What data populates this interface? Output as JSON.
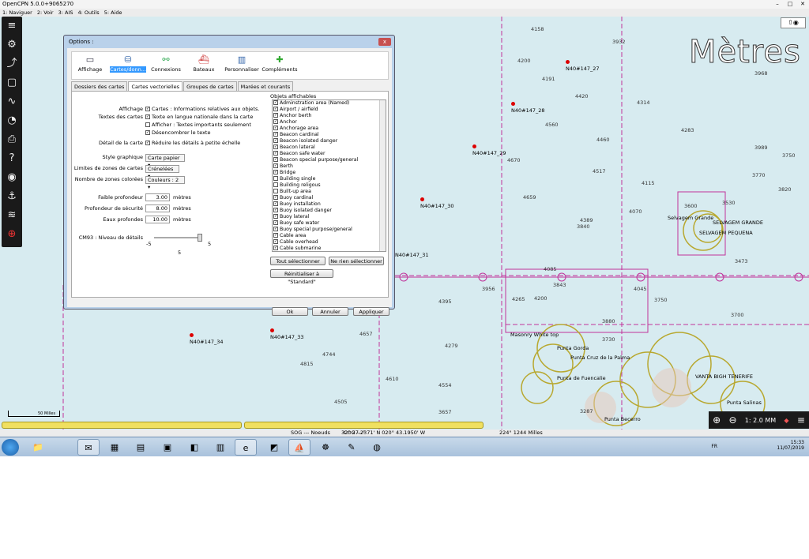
{
  "window": {
    "title": "OpenCPN 5.0.0+9065270"
  },
  "menubar": {
    "items": [
      "1: Naviguer",
      "2: Voir",
      "3: AIS",
      "4: Outils",
      "5: Aide"
    ]
  },
  "chart_overlay": {
    "units_label": "Mètres"
  },
  "depths": [
    {
      "v": "4158"
    },
    {
      "v": "3932"
    },
    {
      "v": "3968"
    },
    {
      "v": "4200"
    },
    {
      "v": "4191"
    },
    {
      "v": "4420"
    },
    {
      "v": "4314"
    },
    {
      "v": "4560"
    },
    {
      "v": "4460"
    },
    {
      "v": "4283"
    },
    {
      "v": "4670"
    },
    {
      "v": "4517"
    },
    {
      "v": "4115"
    },
    {
      "v": "4659"
    },
    {
      "v": "4389"
    },
    {
      "v": "4070"
    },
    {
      "v": "3840"
    },
    {
      "v": "3989"
    },
    {
      "v": "3750"
    },
    {
      "v": "3770"
    },
    {
      "v": "3820"
    },
    {
      "v": "3530"
    },
    {
      "v": "3600"
    },
    {
      "v": "3473"
    },
    {
      "v": "4395"
    },
    {
      "v": "4265"
    },
    {
      "v": "4200"
    },
    {
      "v": "4657"
    },
    {
      "v": "4279"
    },
    {
      "v": "4744"
    },
    {
      "v": "4815"
    },
    {
      "v": "4610"
    },
    {
      "v": "4554"
    },
    {
      "v": "4505"
    },
    {
      "v": "3657"
    },
    {
      "v": "3956"
    },
    {
      "v": "4085"
    },
    {
      "v": "3843"
    },
    {
      "v": "4045"
    },
    {
      "v": "3880"
    },
    {
      "v": "3730"
    },
    {
      "v": "3750"
    },
    {
      "v": "3700"
    },
    {
      "v": "3287"
    }
  ],
  "waypoints": [
    {
      "label": "N40#147_27"
    },
    {
      "label": "N40#147_28"
    },
    {
      "label": "N40#147_29"
    },
    {
      "label": "N40#147_30"
    },
    {
      "label": "N40#147_31"
    },
    {
      "label": "N40#147_33"
    },
    {
      "label": "N40#147_34"
    }
  ],
  "places": [
    {
      "label": "Selvagem Grande"
    },
    {
      "label": "SELVAGEM GRANDE"
    },
    {
      "label": "SELVAGEM PEQUENA"
    },
    {
      "label": "Punta Gorda"
    },
    {
      "label": "Punta Cruz de la Palma"
    },
    {
      "label": "Punta de Fuencalie"
    },
    {
      "label": "VANTA BIGH TENERIFE"
    },
    {
      "label": "Punta Salinas"
    },
    {
      "label": "Punta Becerro"
    },
    {
      "label": "Masonry White top"
    }
  ],
  "scale": {
    "label": "50 Milles",
    "zoom": "1: 2.0 MM"
  },
  "status": {
    "sog": "SOG --- Noeuds",
    "cog": "COG ---°",
    "pos": "32° 27.2371' N   020° 43.1950' W",
    "brg": "224°  1244 Milles"
  },
  "dialog": {
    "title": "Options :",
    "close_label": "x",
    "categories": [
      {
        "label": "Affichage",
        "icon": "display-icon"
      },
      {
        "label": "Cartes/donn...",
        "icon": "charts-icon"
      },
      {
        "label": "Connexions",
        "icon": "connections-icon"
      },
      {
        "label": "Bateaux",
        "icon": "ships-icon"
      },
      {
        "label": "Personnaliser",
        "icon": "customize-icon"
      },
      {
        "label": "Compléments",
        "icon": "plugins-icon"
      }
    ],
    "tabs": [
      "Dossiers des cartes",
      "Cartes vectorielles",
      "Groupes de cartes",
      "Marées et courants"
    ],
    "form": {
      "affichage_label": "Affichage",
      "affichage_cb": "Cartes : Informations relatives aux objets.",
      "textes_label": "Textes des cartes",
      "textes_cb1": "Texte en langue nationale dans la carte",
      "textes_cb2": "Afficher : Textes importants seulement",
      "textes_cb3": "Désencombrer le texte",
      "detail_label": "Détail de la carte",
      "detail_cb": "Réduire les détails à petite échelle",
      "style_label": "Style graphique",
      "style_value": "Carte papier",
      "limites_label": "Limites de zones de cartes",
      "limites_value": "Crénelées",
      "zones_label": "Nombre de zones colorées",
      "zones_value": "Couleurs : 2",
      "faible_label": "Faible profondeur",
      "faible_value": "3.00",
      "securite_label": "Profondeur de sécurité",
      "securite_value": "8.00",
      "eaux_label": "Eaux profondes",
      "eaux_value": "10.00",
      "unit": "mètres",
      "cm93_label": "CM93 : Niveau de détails",
      "slider_min": "-5",
      "slider_max": "5",
      "slider_value": "5"
    },
    "objets_label": "Objets affichables",
    "objets": [
      {
        "t": "Adminstration area (Named)",
        "c": true
      },
      {
        "t": "Airport / airfield",
        "c": true
      },
      {
        "t": "Anchor berth",
        "c": true
      },
      {
        "t": "Anchor",
        "c": true
      },
      {
        "t": "Anchorage area",
        "c": true
      },
      {
        "t": "Beacon cardinal",
        "c": true
      },
      {
        "t": "Beacon isolated danger",
        "c": true
      },
      {
        "t": "Beacon lateral",
        "c": true
      },
      {
        "t": "Beacon safe water",
        "c": true
      },
      {
        "t": "Beacon special purpose/general",
        "c": true
      },
      {
        "t": "Berth",
        "c": true
      },
      {
        "t": "Bridge",
        "c": true
      },
      {
        "t": "Building single",
        "c": false
      },
      {
        "t": "Building religous",
        "c": false
      },
      {
        "t": "Built-up area",
        "c": false
      },
      {
        "t": "Buoy cardinal",
        "c": true
      },
      {
        "t": "Buoy installation",
        "c": true
      },
      {
        "t": "Buoy isolated danger",
        "c": true
      },
      {
        "t": "Buoy lateral",
        "c": true
      },
      {
        "t": "Buoy safe water",
        "c": true
      },
      {
        "t": "Buoy special purpose/general",
        "c": true
      },
      {
        "t": "Cable area",
        "c": true
      },
      {
        "t": "Cable overhead",
        "c": true
      },
      {
        "t": "Cable submarine",
        "c": true
      }
    ],
    "btn_select_all": "Tout sélectionner",
    "btn_select_none": "Ne rien sélectionner",
    "btn_reset": "Réinitialiser à \"Standard\"",
    "btn_ok": "Ok",
    "btn_cancel": "Annuler",
    "btn_apply": "Appliquer"
  },
  "taskbar": {
    "lang": "FR",
    "time": "15:33",
    "date": "11/07/2019"
  },
  "colors": {
    "sea": "#d7ebf0",
    "magenta": "#c0339a",
    "dialog_frame": "#b9d1ea",
    "yellow": "#f0e060"
  }
}
